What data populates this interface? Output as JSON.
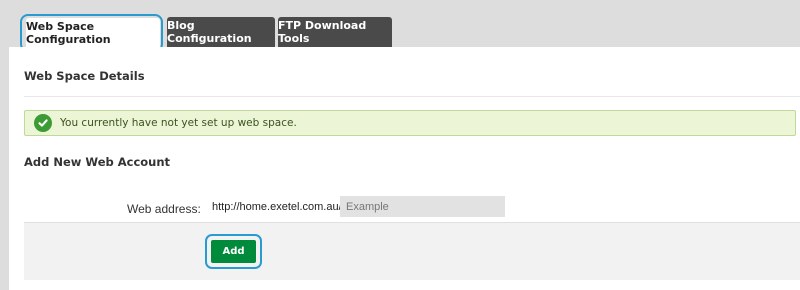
{
  "tabs": [
    {
      "label": "Web Space Configuration",
      "active": true
    },
    {
      "label": "Blog Configuration",
      "active": false
    },
    {
      "label": "FTP Download Tools",
      "active": false
    }
  ],
  "web_space_details": {
    "title": "Web Space Details",
    "notice_text": "You currently have not yet set up web space.",
    "notice_icon": "check-circle-icon"
  },
  "add_account": {
    "title": "Add New Web Account",
    "label": "Web address:",
    "prefix": "http://home.exetel.com.au/",
    "input_value": "",
    "input_placeholder": "Example",
    "button_label": "Add"
  },
  "colors": {
    "tab_inactive_bg": "#4a4a4a",
    "highlight": "#2a9bd0",
    "success_bg": "#ecf5d6",
    "success_icon": "#3d9b35",
    "primary_button": "#008a3c"
  }
}
